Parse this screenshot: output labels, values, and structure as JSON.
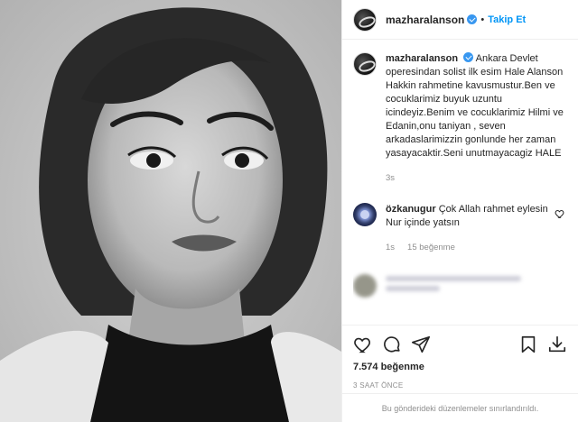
{
  "post": {
    "author": "mazharalanson",
    "follow_label": "Takip Et",
    "dot": "•"
  },
  "caption": {
    "username": "mazharalanson",
    "text": "Ankara Devlet operesindan solist ilk esim Hale Alanson Hakkin rahmetine kavusmustur.Ben ve cocuklarimiz buyuk uzuntu icindeyiz.Benim ve cocuklarimiz Hilmi ve Edanin,onu taniyan , seven arkadaslarimizzin gonlunde her zaman yasayacaktir.Seni unutmayacagiz HALE",
    "time": "3s"
  },
  "comments": [
    {
      "username": "özkanugur",
      "text": "Çok Allah rahmet eylesin Nur içinde yatsın",
      "time": "1s",
      "likes": "15 beğenme"
    }
  ],
  "stats": {
    "likes": "7.574 beğenme",
    "posted": "3 SAAT ÖNCE"
  },
  "footer": {
    "restricted_text": "Bu gönderideki düzenlemeler sınırlandırıldı."
  },
  "icons": {
    "like": "heart-icon",
    "comment": "comment-icon",
    "share": "share-icon",
    "save": "bookmark-icon",
    "download": "download-icon",
    "verified": "verified-badge-icon"
  },
  "colors": {
    "accent": "#0095f6",
    "verified": "#3897f0",
    "muted": "#8e8e8e"
  }
}
